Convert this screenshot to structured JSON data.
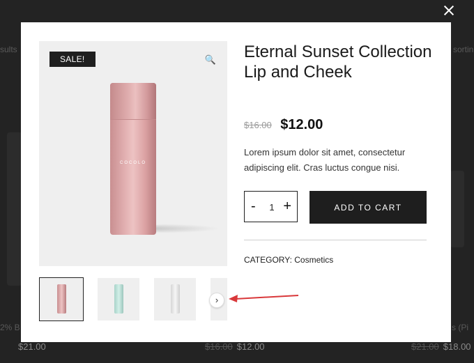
{
  "background": {
    "left_fragment": "sults",
    "right_fragment": "sortin",
    "bottom_left_label": "2% B",
    "bottom_right_label": "s (Pi",
    "prices": [
      {
        "old": "",
        "new": "$21.00"
      },
      {
        "old": "$16.00",
        "new": "$12.00"
      },
      {
        "old": "$21.00",
        "new": "$18.00"
      }
    ]
  },
  "modal": {
    "sale_badge": "SALE!",
    "zoom_icon": "🔍",
    "brand_on_bottle": "COCOLO",
    "title": "Eternal Sunset Collection Lip and Cheek",
    "old_price": "$16.00",
    "price": "$12.00",
    "description": "Lorem ipsum dolor sit amet, consectetur adipiscing elit. Cras luctus congue nisi.",
    "quantity": {
      "minus": "-",
      "value": "1",
      "plus": "+"
    },
    "add_to_cart": "ADD TO CART",
    "category_label": "CATEGORY:",
    "category_value": "Cosmetics",
    "next_arrow": "›"
  },
  "colors": {
    "accent_dark": "#1e1e1e",
    "annotation_arrow": "#d9383a",
    "bottle_pink": "#e2b0b1",
    "bottle_mint": "#bfe3da",
    "bottle_white": "#e8e8e8"
  }
}
